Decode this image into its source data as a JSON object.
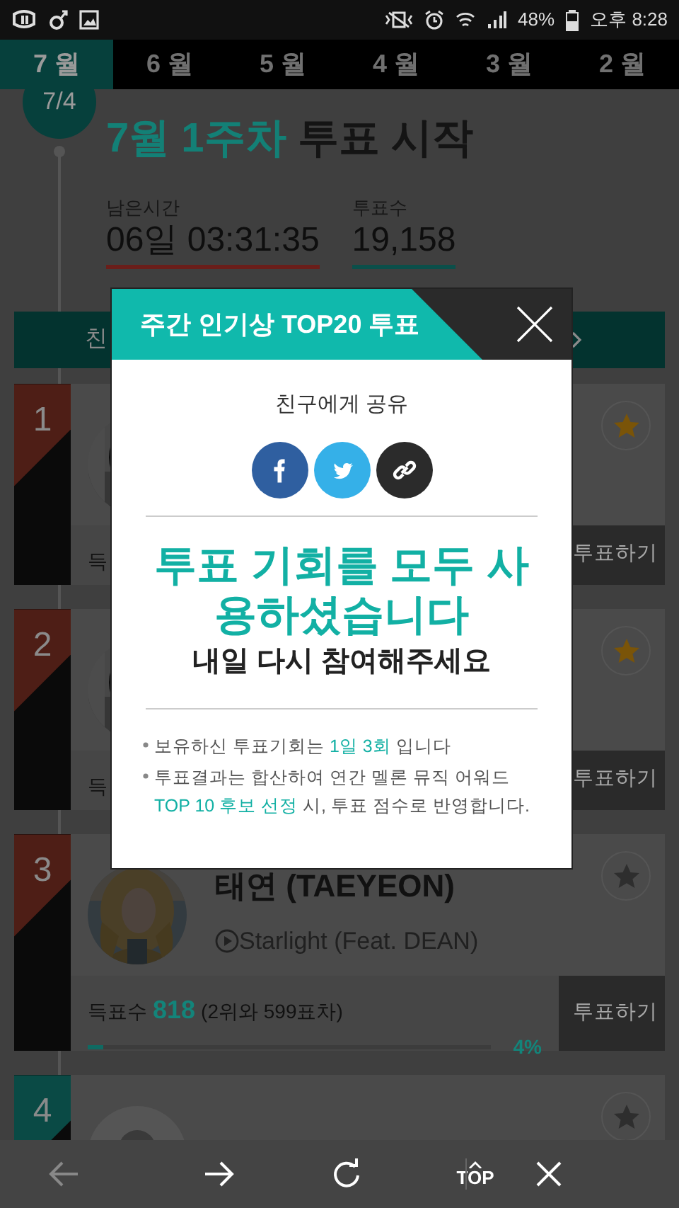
{
  "status_bar": {
    "battery": "48%",
    "time": "오후 8:28"
  },
  "month_tabs": [
    {
      "label": "7 월",
      "selected": true
    },
    {
      "label": "6 월",
      "selected": false
    },
    {
      "label": "5 월",
      "selected": false
    },
    {
      "label": "4 월",
      "selected": false
    },
    {
      "label": "3 월",
      "selected": false
    },
    {
      "label": "2 월",
      "selected": false
    }
  ],
  "header": {
    "date": "7/4",
    "title_highlight": "7월 1주차",
    "title_rest": "투표 시작"
  },
  "stats": [
    {
      "label": "남은시간",
      "value": "06일 03:31:35",
      "color": "#6a1e1a"
    },
    {
      "label": "투표수",
      "value": "19,158",
      "color": "#0b4f4a"
    }
  ],
  "share_bar": {
    "label": "친"
  },
  "cards": [
    {
      "rank": "1",
      "color": "#4e1e16",
      "starred": true,
      "votes_label": "득",
      "vote_button": "투표하기"
    },
    {
      "rank": "2",
      "color": "#4e1e16",
      "starred": true,
      "votes_label": "득",
      "vote_button": "투표하기"
    },
    {
      "rank": "3",
      "color": "#4e1e16",
      "starred": false,
      "name": "태연 (TAEYEON)",
      "song": "Starlight (Feat. DEAN)",
      "votes_label": "득표수",
      "votes": "818",
      "gap": "(2위와 599표차)",
      "level": 0.04,
      "percent": "4%",
      "vote_button": "투표하기"
    },
    {
      "rank": "4",
      "color": "#0a4a45",
      "starred": false,
      "avatar": {
        "kind": "placeholder"
      }
    }
  ],
  "dialog": {
    "title": "주간 인기상 TOP20 투표",
    "share_label": "친구에게 공유",
    "share_buttons": [
      {
        "kind": "facebook"
      },
      {
        "kind": "twitter"
      },
      {
        "kind": "link"
      }
    ],
    "headline": "투표 기회를 모두 사용하셨습니다",
    "subline": "내일 다시 참여해주세요",
    "notes": [
      [
        {
          "text": "보유하신 투표기회는 ",
          "highlight": false
        },
        {
          "text": "1일 3회",
          "highlight": true
        },
        {
          "text": " 입니다",
          "highlight": false
        }
      ],
      [
        {
          "text": "투표결과는 합산하여 연간 멜론 뮤직 어워드 ",
          "highlight": false
        },
        {
          "text": "TOP 10 후보 선정",
          "highlight": true
        },
        {
          "text": " 시, 투표 점수로 반영합니다.",
          "highlight": false
        }
      ]
    ]
  },
  "toolbar": [
    {
      "kind": "back",
      "disabled": true
    },
    {
      "kind": "forward",
      "disabled": false
    },
    {
      "kind": "refresh",
      "disabled": false
    },
    {
      "kind": "top",
      "label": "TOP",
      "disabled": false
    },
    {
      "kind": "close",
      "disabled": false
    }
  ]
}
